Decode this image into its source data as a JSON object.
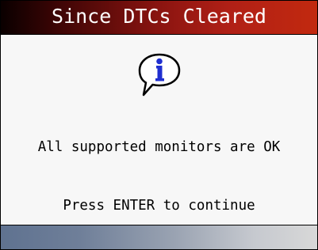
{
  "screen": {
    "title": "Since DTCs Cleared",
    "icon": "info-speech-bubble-icon",
    "message": "All supported monitors are OK",
    "prompt": "Press ENTER to continue"
  },
  "colors": {
    "title_bar_start": "#0a0000",
    "title_bar_end": "#c2290f",
    "title_text": "#ffffff",
    "icon_blue": "#1f2fd0",
    "screen_background": "#f7f7f7",
    "bottom_bar_start": "#5f7290",
    "bottom_bar_end": "#d8d8d8"
  }
}
